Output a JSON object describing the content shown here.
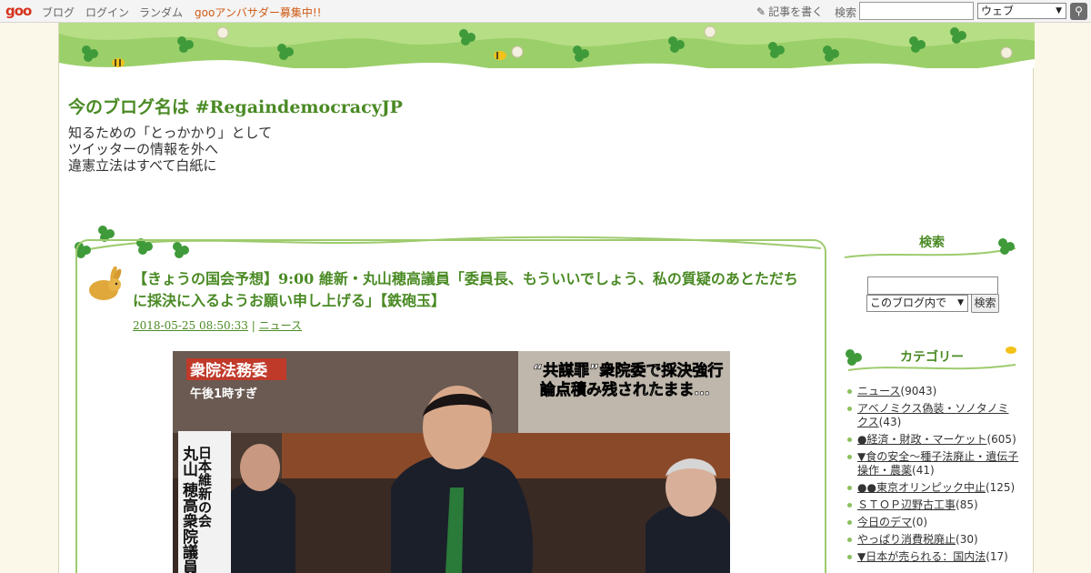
{
  "topbar": {
    "logo": "goo",
    "links": [
      "ブログ",
      "ログイン",
      "ランダム"
    ],
    "ambassador": "gooアンバサダー募集中!!",
    "write": "記事を書く",
    "search_label": "検索",
    "search_scope": "ウェブ"
  },
  "blog": {
    "title": "今のブログ名は #RegaindemocracyJP",
    "description": [
      "知るための「とっかかり」として",
      "ツイッターの情報を外へ",
      "違憲立法はすべて白紙に"
    ]
  },
  "entry": {
    "title": "【きょうの国会予想】9:00 維新・丸山穂高議員「委員長、もういいでしょう、私の質疑のあとただちに採決に入るようお願い申し上げる」【鉄砲玉】",
    "date": "2018-05-25 08:50:33",
    "separator": "|",
    "category": "ニュース",
    "photo_caption_left": [
      "衆院法務委",
      "午後1時すぎ"
    ],
    "photo_caption_right": [
      "“共謀罪”衆院委で採決強行",
      "論点積み残されたまま…"
    ],
    "photo_caption_name": [
      "日本維新の会",
      "丸山 穂高衆院議員"
    ]
  },
  "sidebar": {
    "search_heading": "検索",
    "search_scope": "このブログ内で",
    "search_button": "検索",
    "category_heading": "カテゴリー",
    "categories": [
      {
        "name": "ニュース",
        "count": "(9043)"
      },
      {
        "name": "アベノミクス偽装・ソノタノミクス",
        "count": "(43)"
      },
      {
        "name": "●経済・財政・マーケット",
        "count": "(605)"
      },
      {
        "name": "▼食の安全～種子法廃止・遺伝子操作・農薬",
        "count": "(41)"
      },
      {
        "name": "●●東京オリンピック中止",
        "count": "(125)"
      },
      {
        "name": "ＳＴＯＰ辺野古工事",
        "count": "(85)"
      },
      {
        "name": "今日のデマ",
        "count": "(0)"
      },
      {
        "name": "やっぱり消費税廃止",
        "count": "(30)"
      },
      {
        "name": "▼日本が売られる：国内法",
        "count": "(17)"
      }
    ]
  },
  "colors": {
    "accent_green": "#4a8a24",
    "clover": "#3f9a3a",
    "logo_red": "#d6321e"
  }
}
